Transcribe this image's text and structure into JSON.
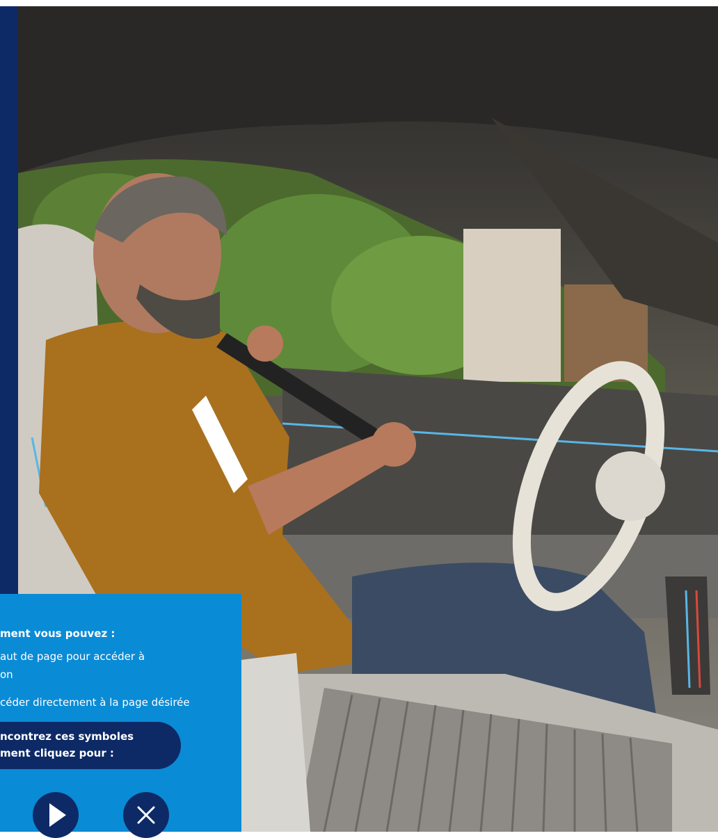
{
  "photo": {
    "description_icon": "car-interior-photo-icon"
  },
  "info": {
    "line1": "ment vous pouvez :",
    "line2": "aut de page pour accéder à",
    "line3": "on",
    "line4": "céder directement à la page désirée",
    "pill_line1": "ncontrez ces symboles",
    "pill_line2": "ment cliquez pour :"
  },
  "buttons": {
    "play_icon": "play-icon",
    "close_icon": "close-icon"
  },
  "colors": {
    "navy": "#0d2a66",
    "blue": "#0a8bd6",
    "white": "#ffffff"
  }
}
